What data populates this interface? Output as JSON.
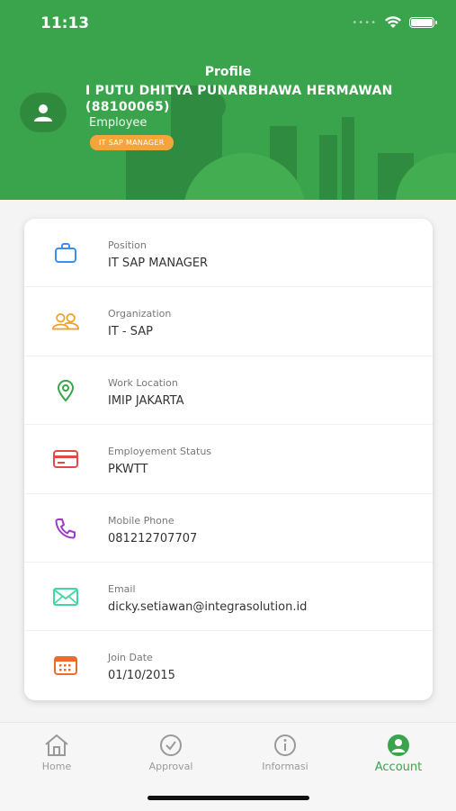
{
  "status_bar": {
    "time": "11:13"
  },
  "header": {
    "title": "Profile",
    "name": "I PUTU DHITYA PUNARBHAWA HERMAWAN (88100065)",
    "role": "Employee",
    "badge": "IT SAP MANAGER",
    "colors": {
      "header_green": "#3aa44c",
      "badge_orange": "#f4a53a"
    }
  },
  "details": [
    {
      "label": "Position",
      "value": "IT SAP MANAGER",
      "icon": "briefcase-icon",
      "color": "#3b8ff0"
    },
    {
      "label": "Organization",
      "value": "IT - SAP",
      "icon": "people-icon",
      "color": "#f0a020"
    },
    {
      "label": "Work Location",
      "value": "IMIP JAKARTA",
      "icon": "location-pin-icon",
      "color": "#3aa44c"
    },
    {
      "label": "Employement Status",
      "value": "PKWTT",
      "icon": "card-icon",
      "color": "#e24a4a"
    },
    {
      "label": "Mobile Phone",
      "value": "081212707707",
      "icon": "phone-icon",
      "color": "#9c3bc6"
    },
    {
      "label": "Email",
      "value": "dicky.setiawan@integrasolution.id",
      "icon": "envelope-icon",
      "color": "#45d6a0"
    },
    {
      "label": "Join Date",
      "value": "01/10/2015",
      "icon": "calendar-icon",
      "color": "#f06a2a"
    }
  ],
  "tabs": [
    {
      "label": "Home",
      "icon": "home-icon"
    },
    {
      "label": "Approval",
      "icon": "check-circle-icon"
    },
    {
      "label": "Informasi",
      "icon": "info-icon"
    },
    {
      "label": "Account",
      "icon": "account-icon",
      "active": true
    }
  ]
}
